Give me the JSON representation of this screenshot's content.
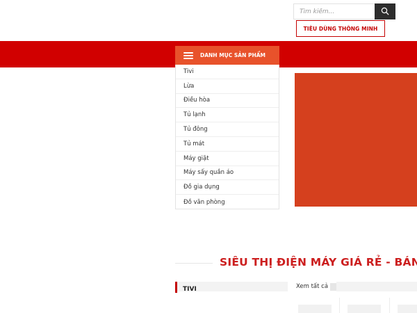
{
  "header": {
    "search": {
      "placeholder": "Tìm kiếm...",
      "icon": "search-icon"
    },
    "promo_button_label": "TIÊU DÙNG THÔNG MINH"
  },
  "nav": {
    "category_title": "DANH MỤC SẢN PHẨM",
    "category_icon": "hamburger-menu-icon",
    "categories": [
      "Tivi",
      "Lừa",
      "Điều hòa",
      "Tủ lạnh",
      "Tủ đông",
      "Tủ mát",
      "Máy giặt",
      "Máy sấy quần áo",
      "Đồ gia dụng",
      "Đồ văn phòng"
    ]
  },
  "main": {
    "section_title": "SIÊU THỊ ĐIỆN MÁY GIÁ RẺ - BÁN",
    "tivi_block": {
      "label": "TIVI",
      "see_all": "Xem tất cả"
    }
  },
  "colors": {
    "brand_red": "#d10000",
    "category_orange": "#e8522b",
    "banner_orange": "#d5401e",
    "section_title_red": "#cc1f1f",
    "search_button_dark": "#2d2d2d"
  }
}
